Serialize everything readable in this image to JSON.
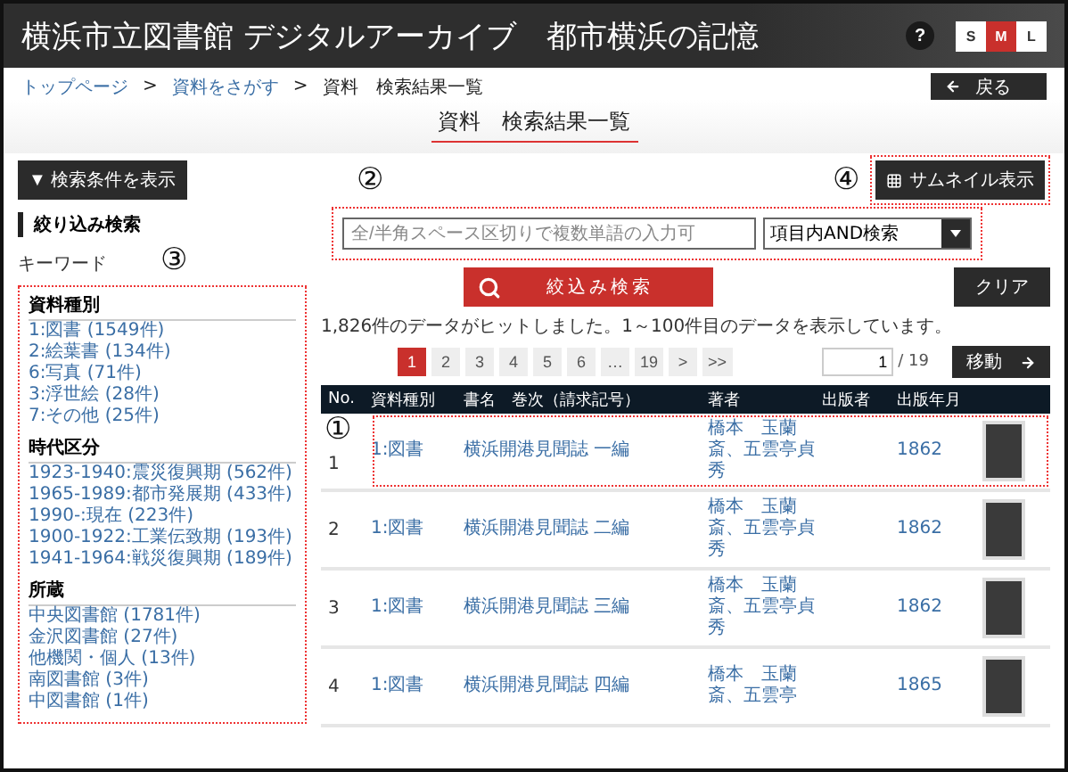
{
  "header": {
    "title": "横浜市立図書館 デジタルアーカイブ　都市横浜の記憶",
    "help": "?",
    "font_sizes": [
      {
        "label": "S",
        "selected": false
      },
      {
        "label": "M",
        "selected": true
      },
      {
        "label": "L",
        "selected": false
      }
    ]
  },
  "breadcrumb": [
    {
      "label": "トップページ",
      "kind": "link"
    },
    {
      "label": ">",
      "kind": "separator"
    },
    {
      "label": "資料をさがす",
      "kind": "link"
    },
    {
      "label": ">",
      "kind": "separator"
    },
    {
      "label": "資料　検索結果一覧",
      "kind": "current"
    }
  ],
  "back_button": "戻る",
  "page_title": "資料　検索結果一覧",
  "show_conditions_button": "▼ 検索条件を表示",
  "thumbnail_button": "サムネイル表示",
  "refine": {
    "heading": "絞り込み検索",
    "keyword_label": "キーワード",
    "placeholder": "全/半角スペース区切りで複数単語の入力可",
    "mode": "項目内AND検索",
    "search_button": "絞込み検索",
    "clear_button": "クリア"
  },
  "facets": [
    {
      "heading": "資料種別",
      "items": [
        "1:図書 (1549件)",
        "2:絵葉書 (134件)",
        "6:写真 (71件)",
        "3:浮世絵 (28件)",
        "7:その他 (25件)"
      ]
    },
    {
      "heading": "時代区分",
      "items": [
        "1923-1940:震災復興期 (562件)",
        "1965-1989:都市発展期 (433件)",
        "1990-:現在 (223件)",
        "1900-1922:工業伝致期 (193件)",
        "1941-1964:戦災復興期 (189件)"
      ]
    },
    {
      "heading": "所蔵",
      "items": [
        "中央図書館 (1781件)",
        "金沢図書館 (27件)",
        "他機関・個人 (13件)",
        "南図書館 (3件)",
        "中図書館 (1件)"
      ]
    }
  ],
  "result_summary": "1,826件のデータがヒットしました。1～100件目のデータを表示しています。",
  "pagination": {
    "pages": [
      {
        "label": "1",
        "selected": true
      },
      {
        "label": "2",
        "selected": false
      },
      {
        "label": "3",
        "selected": false
      },
      {
        "label": "4",
        "selected": false
      },
      {
        "label": "5",
        "selected": false
      },
      {
        "label": "6",
        "selected": false
      },
      {
        "label": "…",
        "selected": false
      },
      {
        "label": "19",
        "selected": false
      },
      {
        "label": ">",
        "selected": false
      },
      {
        "label": ">>",
        "selected": false
      }
    ],
    "page_input": "1",
    "total": "/ 19",
    "go_button": "移動"
  },
  "table": {
    "columns": [
      "No.",
      "資料種別",
      "書名　巻次（請求記号）",
      "著者",
      "出版者",
      "出版年月"
    ],
    "rows": [
      {
        "no": "1",
        "type": "1:図書",
        "title": "横浜開港見聞誌 一編",
        "author": "橋本　玉蘭斎、五雲亭貞秀",
        "year": "1862"
      },
      {
        "no": "2",
        "type": "1:図書",
        "title": "横浜開港見聞誌 二編",
        "author": "橋本　玉蘭斎、五雲亭貞秀",
        "year": "1862"
      },
      {
        "no": "3",
        "type": "1:図書",
        "title": "横浜開港見聞誌 三編",
        "author": "橋本　玉蘭斎、五雲亭貞秀",
        "year": "1862"
      },
      {
        "no": "4",
        "type": "1:図書",
        "title": "横浜開港見聞誌 四編",
        "author": "橋本　玉蘭斎、五雲亭",
        "year": "1865"
      }
    ]
  },
  "annotations": [
    {
      "label": "①",
      "kind": "row"
    },
    {
      "label": "②",
      "kind": "search"
    },
    {
      "label": "③",
      "kind": "facets"
    },
    {
      "label": "④",
      "kind": "thumbnail"
    }
  ]
}
